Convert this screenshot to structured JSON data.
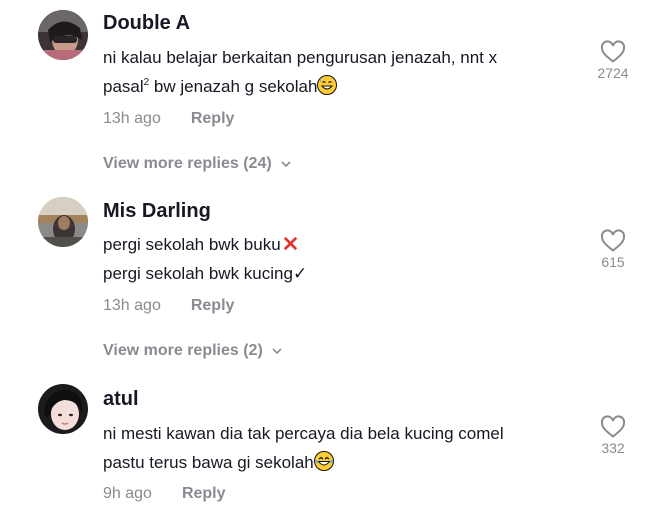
{
  "comments": [
    {
      "username": "Double A",
      "line1": "ni kalau belajar berkaitan pengurusan jenazah, nnt x",
      "line2_pre": "pasal",
      "line2_sup": "2",
      "line2_post": " bw jenazah g sekolah",
      "line2_emoji": "grinning-sweat-emoji",
      "time": "13h ago",
      "reply_label": "Reply",
      "likes": "2724",
      "more_replies": "View more replies (24)"
    },
    {
      "username": "Mis Darling",
      "line1": "pergi sekolah bwk buku",
      "line1_icon": "cross-mark-emoji",
      "line2": "pergi sekolah bwk kucing",
      "line2_icon": "check-mark",
      "check_glyph": "✓",
      "time": "13h ago",
      "reply_label": "Reply",
      "likes": "615",
      "more_replies": "View more replies (2)"
    },
    {
      "username": "atul",
      "line1": "ni mesti kawan dia tak percaya dia bela kucing comel",
      "line2": "pastu terus bawa gi sekolah",
      "line2_emoji": "laughing-tears-emoji",
      "time": "9h ago",
      "reply_label": "Reply",
      "likes": "332"
    }
  ],
  "colors": {
    "text": "#161823",
    "muted": "#8a8b91",
    "background": "#ffffff",
    "cross": "#e0312e"
  }
}
